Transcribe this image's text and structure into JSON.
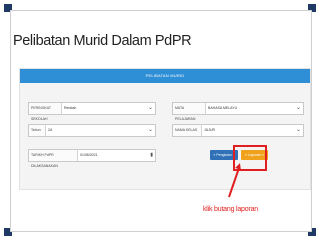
{
  "page_title": "Pelibatan Murid Dalam PdPR",
  "panel": {
    "header": "PELIBATAN MURID"
  },
  "form": {
    "peringkat": {
      "label": "PERINGKAT SEKOLAH",
      "value": "Rendah"
    },
    "mata_pelajaran": {
      "label": "MATA PELAJARAN",
      "value": "BAHASA MELAYU"
    },
    "tahun": {
      "label": "Tahun",
      "value": "2A"
    },
    "nama_kelas": {
      "label": "NAMA KELAS",
      "value": "JUJUR"
    },
    "tarikh": {
      "label": "TARIKH PdPR DILAKSANAKAN",
      "value": "01/06/2021"
    }
  },
  "buttons": {
    "pengisian": "« Pengisian »",
    "laporan": "» Laporan »"
  },
  "annotation": {
    "callout": "klik butang laporan",
    "color": "#e02020"
  },
  "icons": {
    "select_caret": "chevron-down-icon",
    "calendar": "calendar-icon"
  }
}
